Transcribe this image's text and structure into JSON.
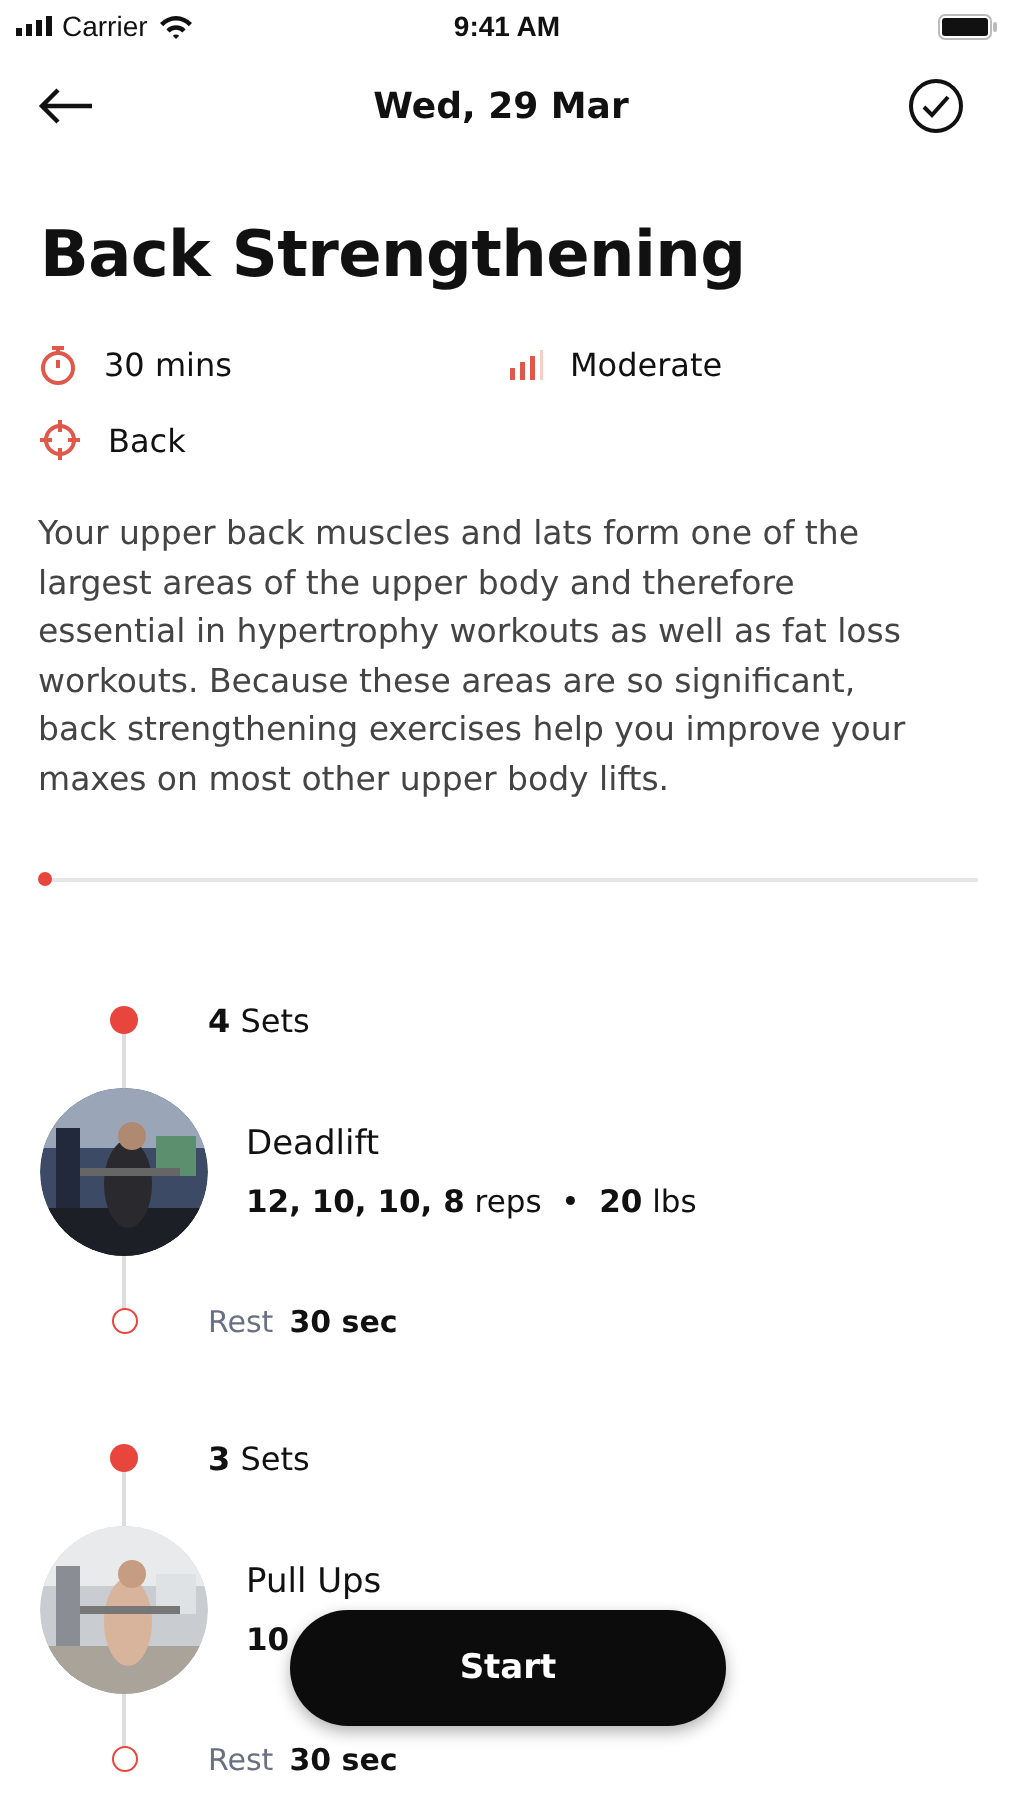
{
  "status_bar": {
    "carrier": "Carrier",
    "time": "9:41 AM"
  },
  "header": {
    "title": "Wed, 29 Mar"
  },
  "workout": {
    "title": "Back Strengthening",
    "duration": "30 mins",
    "difficulty": "Moderate",
    "target": "Back",
    "description": "Your upper back muscles and lats form one of the largest areas of the upper body and therefore essential in hypertrophy workouts as well as fat loss workouts. Because these areas are so significant, back strengthening exercises help you improve your maxes on most other upper body lifts.",
    "progress": {
      "level": 0
    }
  },
  "exercises": [
    {
      "sets": "**4** Sets",
      "name": "Deadlift",
      "detail": "**12, 10, 10, 8** reps  •  **20** lbs",
      "rest_label": "Rest",
      "rest": "30 sec"
    },
    {
      "sets": "**3** Sets",
      "name": "Pull Ups",
      "detail": "**10**",
      "rest_label": "Rest",
      "rest": "30 sec"
    }
  ],
  "start_button": "Start"
}
